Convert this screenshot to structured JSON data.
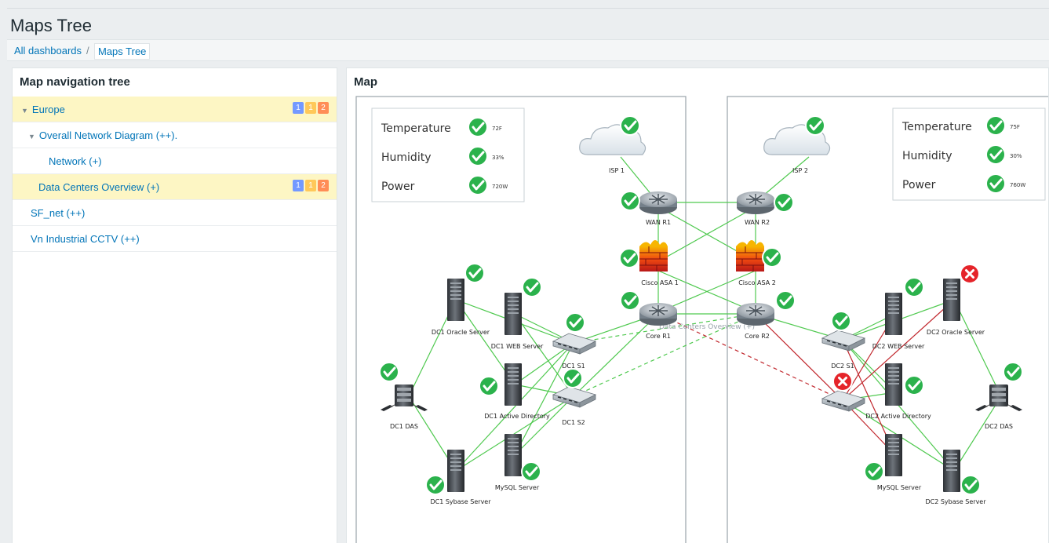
{
  "page": {
    "title": "Maps Tree"
  },
  "breadcrumb": {
    "items": [
      "All dashboards",
      "Maps Tree"
    ],
    "separator": "/"
  },
  "nav_panel": {
    "title": "Map navigation tree",
    "rows": [
      {
        "label": "Europe",
        "expanded": true,
        "highlighted": true,
        "badges": [
          "1",
          "1",
          "2"
        ]
      },
      {
        "label": "Overall Network Diagram (++).",
        "expanded": true,
        "highlighted": false
      },
      {
        "label": "Network (+)",
        "highlighted": false
      },
      {
        "label": "Data Centers Overview (+)",
        "highlighted": true,
        "badges": [
          "1",
          "1",
          "2"
        ]
      },
      {
        "label": "SF_net (++)",
        "highlighted": false
      },
      {
        "label": "Vn Industrial CCTV (++)",
        "highlighted": false
      }
    ]
  },
  "map_panel": {
    "title": "Map",
    "dc1_env": {
      "rows": [
        {
          "label": "Temperature",
          "value": "72F"
        },
        {
          "label": "Humidity",
          "value": "33%"
        },
        {
          "label": "Power",
          "value": "720W"
        }
      ]
    },
    "dc2_env": {
      "rows": [
        {
          "label": "Temperature",
          "value": "75F"
        },
        {
          "label": "Humidity",
          "value": "30%"
        },
        {
          "label": "Power",
          "value": "760W"
        }
      ]
    },
    "nodes": {
      "isp1": "ISP 1",
      "isp2": "ISP 2",
      "wanr1": "WAN R1",
      "wanr2": "WAN R2",
      "asa1": "Cisco ASA 1",
      "asa2": "Cisco ASA 2",
      "core1": "Core R1",
      "core2": "Core R2",
      "dc1oracle": "DC1 Oracle Server",
      "dc1web": "DC1 WEB Server",
      "dc1s1": "DC1 S1",
      "dc1s2": "DC1 S2",
      "dc1das": "DC1 DAS",
      "dc1ad": "DC1 Active Directory",
      "dc1sybase": "DC1 Sybase Server",
      "dc1mysql": "MySQL Server",
      "dc2web": "DC2 WEB Server",
      "dc2oracle": "DC2 Oracle Server",
      "dc2s1": "DC2 S1",
      "dc2ad": "DC2 Active Directory",
      "dc2das": "DC2 DAS",
      "dc2mysql": "MySQL Server",
      "dc2sybase": "DC2 Sybase Server",
      "link_label": "Data Centers Overview (+)"
    },
    "status_ok_color": "#2bb24c",
    "status_problem_color": "#e5242a",
    "link_ok_color": "#4fc94f",
    "link_problem_color": "#c1272d"
  }
}
